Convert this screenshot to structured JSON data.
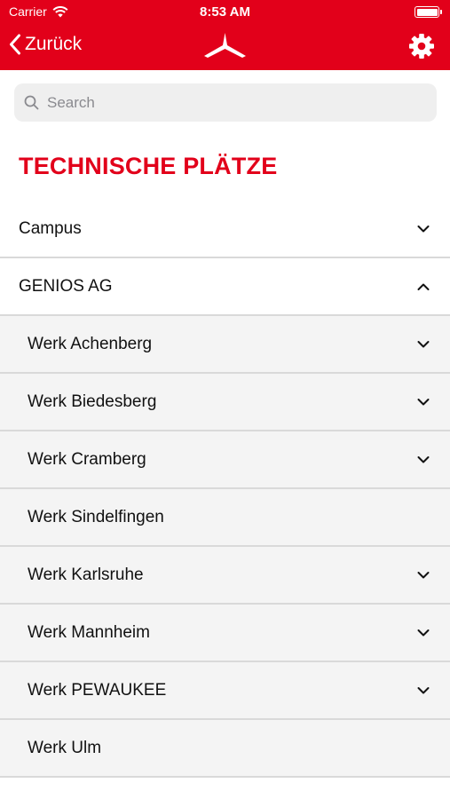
{
  "status_bar": {
    "carrier": "Carrier",
    "time": "8:53 AM"
  },
  "nav": {
    "back_label": "Zurück"
  },
  "search": {
    "placeholder": "Search"
  },
  "section_title": "TECHNISCHE PLÄTZE",
  "colors": {
    "brand": "#e2001a",
    "sub_row_bg": "#f4f4f4",
    "divider": "#d9d9d9"
  },
  "list": [
    {
      "label": "Campus",
      "level": "top",
      "chevron": "chevron-down-icon"
    },
    {
      "label": "GENIOS AG",
      "level": "top",
      "chevron": "chevron-up-icon"
    },
    {
      "label": "Werk Achenberg",
      "level": "sub",
      "chevron": "chevron-down-icon"
    },
    {
      "label": "Werk Biedesberg",
      "level": "sub",
      "chevron": "chevron-down-icon"
    },
    {
      "label": "Werk Cramberg",
      "level": "sub",
      "chevron": "chevron-down-icon"
    },
    {
      "label": "Werk Sindelfingen",
      "level": "sub",
      "chevron": ""
    },
    {
      "label": "Werk Karlsruhe",
      "level": "sub",
      "chevron": "chevron-down-icon"
    },
    {
      "label": "Werk Mannheim",
      "level": "sub",
      "chevron": "chevron-down-icon"
    },
    {
      "label": "Werk PEWAUKEE",
      "level": "sub",
      "chevron": "chevron-down-icon"
    },
    {
      "label": "Werk Ulm",
      "level": "sub",
      "chevron": ""
    }
  ]
}
